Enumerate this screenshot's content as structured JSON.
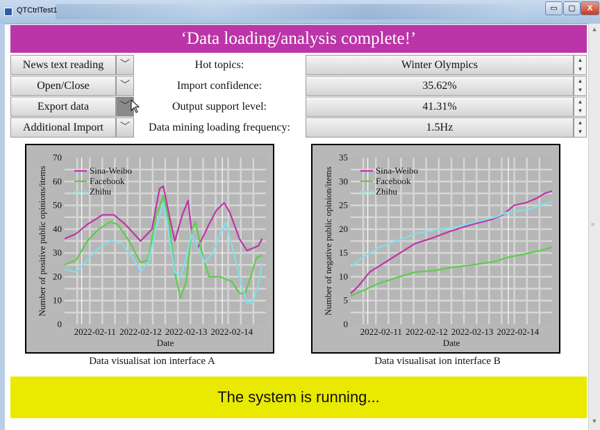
{
  "window": {
    "title": "QTCtrlTest1",
    "minimize_glyph": "▭",
    "maximize_glyph": "▢",
    "close_glyph": "X"
  },
  "banner": {
    "text": "‘Data loading/analysis complete!’",
    "color": "#bc35a8"
  },
  "controls": [
    {
      "button": "News text reading",
      "label": "Hot topics:",
      "value": "Winter Olympics"
    },
    {
      "button": "Open/Close",
      "label": "Import confidence:",
      "value": "35.62%"
    },
    {
      "button": "Export data",
      "label": "Output support level:",
      "value": "41.31%"
    },
    {
      "button": "Additional Import",
      "label": "Data mining loading frequency:",
      "value": "1.5Hz"
    }
  ],
  "icons": {
    "dropdown": "chevron-down-icon",
    "spin_up": "spin-up-icon",
    "spin_down": "spin-down-icon",
    "cursor": "mouse-pointer-icon"
  },
  "chart_data": [
    {
      "type": "line",
      "xlabel": "Date",
      "ylabel": "Number of positive public opinions/items",
      "x_ticks": [
        "2022-02-11",
        "2022-02-12",
        "2022-02-13",
        "2022-02-14"
      ],
      "ylim": [
        0,
        70
      ],
      "y_ticks": [
        "0",
        "10",
        "20",
        "30",
        "40",
        "50",
        "60",
        "70"
      ],
      "legend_position": "top-left",
      "grid": true,
      "series": [
        {
          "name": "Sina-Weibo",
          "color": "#bc35a8",
          "points": [
            [
              0,
              36
            ],
            [
              0.3,
              38
            ],
            [
              0.6,
              42
            ],
            [
              1.0,
              46
            ],
            [
              1.3,
              46
            ],
            [
              1.6,
              42
            ],
            [
              2.0,
              35
            ],
            [
              2.3,
              40
            ],
            [
              2.5,
              57
            ],
            [
              2.6,
              58
            ],
            [
              2.75,
              46
            ],
            [
              2.9,
              35
            ],
            [
              3.1,
              46
            ],
            [
              3.25,
              52
            ],
            [
              3.35,
              38
            ],
            [
              3.5,
              32
            ],
            [
              3.8,
              42
            ],
            [
              4.0,
              48
            ],
            [
              4.2,
              51
            ],
            [
              4.35,
              47
            ],
            [
              4.6,
              36
            ],
            [
              4.8,
              31
            ],
            [
              5.1,
              33
            ],
            [
              5.2,
              36
            ]
          ]
        },
        {
          "name": "Facebook",
          "color": "#5ccd4a",
          "points": [
            [
              0,
              25
            ],
            [
              0.3,
              27
            ],
            [
              0.6,
              35
            ],
            [
              0.9,
              40
            ],
            [
              1.2,
              43
            ],
            [
              1.4,
              42
            ],
            [
              1.7,
              35
            ],
            [
              2.0,
              26
            ],
            [
              2.2,
              27
            ],
            [
              2.4,
              45
            ],
            [
              2.6,
              54
            ],
            [
              2.75,
              43
            ],
            [
              2.9,
              22
            ],
            [
              3.05,
              11
            ],
            [
              3.2,
              18
            ],
            [
              3.35,
              40
            ],
            [
              3.45,
              43
            ],
            [
              3.6,
              31
            ],
            [
              3.8,
              20
            ],
            [
              4.1,
              20
            ],
            [
              4.4,
              18
            ],
            [
              4.6,
              13
            ],
            [
              4.75,
              13
            ],
            [
              4.9,
              20
            ],
            [
              5.05,
              28
            ],
            [
              5.2,
              29
            ]
          ]
        },
        {
          "name": "Zhihu",
          "color": "#7ee0ea",
          "points": [
            [
              0,
              23
            ],
            [
              0.3,
              22
            ],
            [
              0.6,
              27
            ],
            [
              0.9,
              32
            ],
            [
              1.2,
              35
            ],
            [
              1.5,
              34
            ],
            [
              1.8,
              28
            ],
            [
              2.0,
              22
            ],
            [
              2.2,
              26
            ],
            [
              2.4,
              40
            ],
            [
              2.6,
              51
            ],
            [
              2.75,
              37
            ],
            [
              2.9,
              22
            ],
            [
              3.05,
              20
            ],
            [
              3.2,
              28
            ],
            [
              3.35,
              38
            ],
            [
              3.5,
              32
            ],
            [
              3.7,
              26
            ],
            [
              3.9,
              30
            ],
            [
              4.1,
              38
            ],
            [
              4.25,
              43
            ],
            [
              4.45,
              30
            ],
            [
              4.65,
              17
            ],
            [
              4.8,
              9
            ],
            [
              4.95,
              9
            ],
            [
              5.1,
              17
            ],
            [
              5.2,
              26
            ]
          ]
        }
      ]
    },
    {
      "type": "line",
      "xlabel": "Date",
      "ylabel": "Number of negative public opinion/items",
      "x_ticks": [
        "2022-02-11",
        "2022-02-12",
        "2022-02-13",
        "2022-02-14"
      ],
      "ylim": [
        0,
        35
      ],
      "y_ticks": [
        "0",
        "5",
        "10",
        "15",
        "20",
        "25",
        "30",
        "35"
      ],
      "legend_position": "top-left",
      "grid": true,
      "series": [
        {
          "name": "Sina-Weibo",
          "color": "#bc35a8",
          "points": [
            [
              0,
              6.5
            ],
            [
              0.2,
              8
            ],
            [
              0.5,
              11
            ],
            [
              0.9,
              13
            ],
            [
              1.3,
              15
            ],
            [
              1.7,
              17
            ],
            [
              2.1,
              18
            ],
            [
              2.6,
              19.5
            ],
            [
              3.2,
              21
            ],
            [
              3.7,
              22
            ],
            [
              4.0,
              23
            ],
            [
              4.3,
              25
            ],
            [
              4.6,
              25.5
            ],
            [
              4.9,
              26.5
            ],
            [
              5.1,
              27.5
            ],
            [
              5.3,
              28
            ]
          ]
        },
        {
          "name": "Facebook",
          "color": "#5ccd4a",
          "points": [
            [
              0,
              6
            ],
            [
              0.3,
              7
            ],
            [
              0.7,
              8.5
            ],
            [
              1.2,
              9.8
            ],
            [
              1.7,
              11
            ],
            [
              2.2,
              11.3
            ],
            [
              2.7,
              12
            ],
            [
              3.2,
              12.5
            ],
            [
              3.8,
              13.2
            ],
            [
              4.1,
              14
            ],
            [
              4.6,
              14.8
            ],
            [
              5.0,
              15.5
            ],
            [
              5.3,
              16.2
            ]
          ]
        },
        {
          "name": "Zhihu",
          "color": "#7ee0ea",
          "points": [
            [
              0,
              12
            ],
            [
              0.3,
              14
            ],
            [
              0.7,
              16
            ],
            [
              1.2,
              17.5
            ],
            [
              1.7,
              19
            ],
            [
              2.2,
              19.8
            ],
            [
              2.8,
              20.5
            ],
            [
              3.3,
              21.5
            ],
            [
              3.8,
              22.5
            ],
            [
              4.1,
              23.5
            ],
            [
              4.6,
              24
            ],
            [
              5.0,
              25
            ],
            [
              5.3,
              25.8
            ]
          ]
        }
      ]
    }
  ],
  "captions": {
    "a": "Data visualisat ion interface A",
    "b": "Data visualisat ion interface B"
  },
  "status": {
    "text": "The system is running...",
    "color": "#eaea00"
  }
}
